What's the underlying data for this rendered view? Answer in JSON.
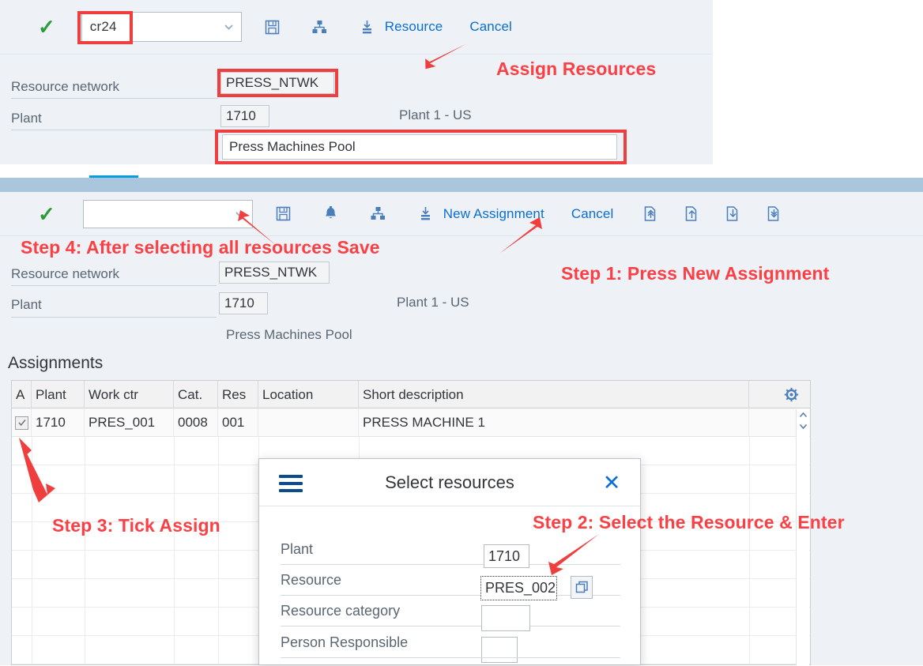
{
  "panel1": {
    "toolbar": {
      "confirm_icon": "green-check-icon",
      "combo_value": "cr24",
      "combo_chevron": "chevron-down-icon",
      "save_icon": "save-floppy-icon",
      "hierarchy_icon": "hierarchy-icon",
      "assign_icon": "assign-down-icon",
      "resource_label": "Resource",
      "cancel_label": "Cancel"
    },
    "form": {
      "resource_network_label": "Resource network",
      "resource_network_value": "PRESS_NTWK",
      "plant_label": "Plant",
      "plant_value": "1710",
      "plant_text": "Plant 1 - US",
      "description_value": "Press Machines Pool"
    },
    "annotation": "Assign Resources"
  },
  "panel2": {
    "toolbar": {
      "confirm_icon": "green-check-icon",
      "combo_value": "",
      "combo_chevron": "chevron-down-icon",
      "save_icon": "save-floppy-icon",
      "alert_icon": "bell-icon",
      "hierarchy_icon": "hierarchy-icon",
      "assign_icon": "assign-down-icon",
      "new_assignment_label": "New Assignment",
      "cancel_label": "Cancel",
      "move_top_icon": "move-to-top-icon",
      "move_up_icon": "move-up-icon",
      "move_down_icon": "move-down-icon",
      "move_bottom_icon": "move-to-bottom-icon"
    },
    "form": {
      "resource_network_label": "Resource network",
      "resource_network_value": "PRESS_NTWK",
      "plant_label": "Plant",
      "plant_value": "1710",
      "plant_text": "Plant 1 - US",
      "description_text": "Press Machines Pool"
    },
    "table": {
      "title": "Assignments",
      "settings_icon": "gear-icon",
      "scroll_up_icon": "chevron-up-icon",
      "scroll_down_icon": "chevron-down-icon",
      "columns": [
        "A",
        "Plant",
        "Work ctr",
        "Cat.",
        "Res",
        "Location",
        "Short description"
      ],
      "rows": [
        {
          "assigned": true,
          "plant": "1710",
          "work_ctr": "PRES_001",
          "cat": "0008",
          "res": "001",
          "location": "",
          "short_description": "PRESS MACHINE 1"
        }
      ]
    },
    "annotations": {
      "step4": "Step 4: After selecting all resources Save",
      "step1": "Step 1: Press New Assignment",
      "step3": "Step 3: Tick Assign",
      "step2": "Step 2: Select the Resource & Enter"
    }
  },
  "dialog": {
    "menu_icon": "hamburger-menu-icon",
    "title": "Select resources",
    "close_icon": "close-x-icon",
    "fields": [
      {
        "label": "Plant",
        "value": "1710"
      },
      {
        "label": "Resource",
        "value": "PRES_002"
      },
      {
        "label": "Resource category",
        "value": ""
      },
      {
        "label": "Person Responsible",
        "value": ""
      }
    ],
    "value_help_icon": "value-help-icon"
  },
  "colors": {
    "panel_bg": "#eef2f6",
    "accent_link": "#0a6ed1",
    "annotation_red": "#fa4045",
    "highlight_box": "#ef3e3e",
    "tab_blue": "#0a9ddf",
    "divider_blue": "#aac6dd",
    "confirm_green": "#2b9b37"
  }
}
